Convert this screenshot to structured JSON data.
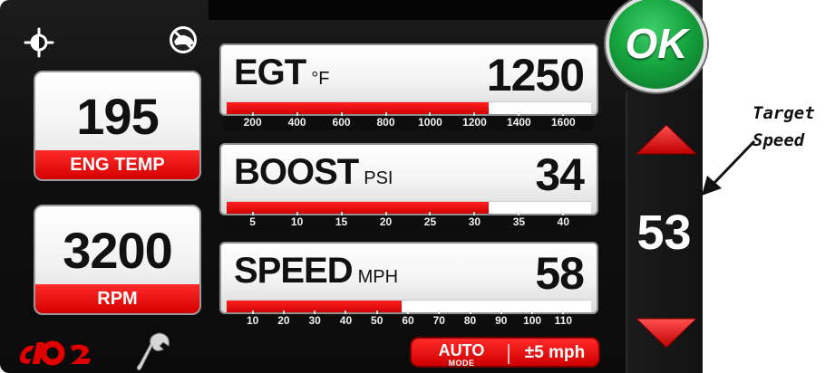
{
  "header": {
    "brightness_icon": "brightness-sun-icon",
    "nodrive_icon": "no-drive-shoe-icon"
  },
  "tiles": {
    "eng_temp": {
      "value": "195",
      "label": "ENG TEMP"
    },
    "rpm": {
      "value": "3200",
      "label": "RPM"
    }
  },
  "gauges": {
    "egt": {
      "name": "EGT",
      "unit": "°F",
      "value": "1250",
      "fill_fraction": 0.72,
      "ticks": [
        "200",
        "400",
        "600",
        "800",
        "1000",
        "1200",
        "1400",
        "1600"
      ]
    },
    "boost": {
      "name": "BOOST",
      "unit": "PSI",
      "value": "34",
      "fill_fraction": 0.72,
      "ticks": [
        "5",
        "10",
        "15",
        "20",
        "25",
        "30",
        "35",
        "40"
      ]
    },
    "speed": {
      "name": "SPEED",
      "unit": "MPH",
      "value": "58",
      "fill_fraction": 0.48,
      "ticks": [
        "10",
        "20",
        "30",
        "40",
        "50",
        "60",
        "70",
        "80",
        "90",
        "100",
        "110"
      ]
    }
  },
  "controls": {
    "ok_label": "OK",
    "target_speed": "53"
  },
  "mode": {
    "auto_label": "AUTO",
    "mode_sublabel": "MODE",
    "tolerance_label": "±5 mph"
  },
  "brand": {
    "logo_icon": "iq2-logo-icon",
    "wrench_icon": "wrench-icon"
  },
  "annotation": {
    "line1": "Target",
    "line2": "Speed"
  },
  "colors": {
    "accent_red": "#e00000",
    "ok_green": "#16a53f",
    "background": "#101010"
  }
}
